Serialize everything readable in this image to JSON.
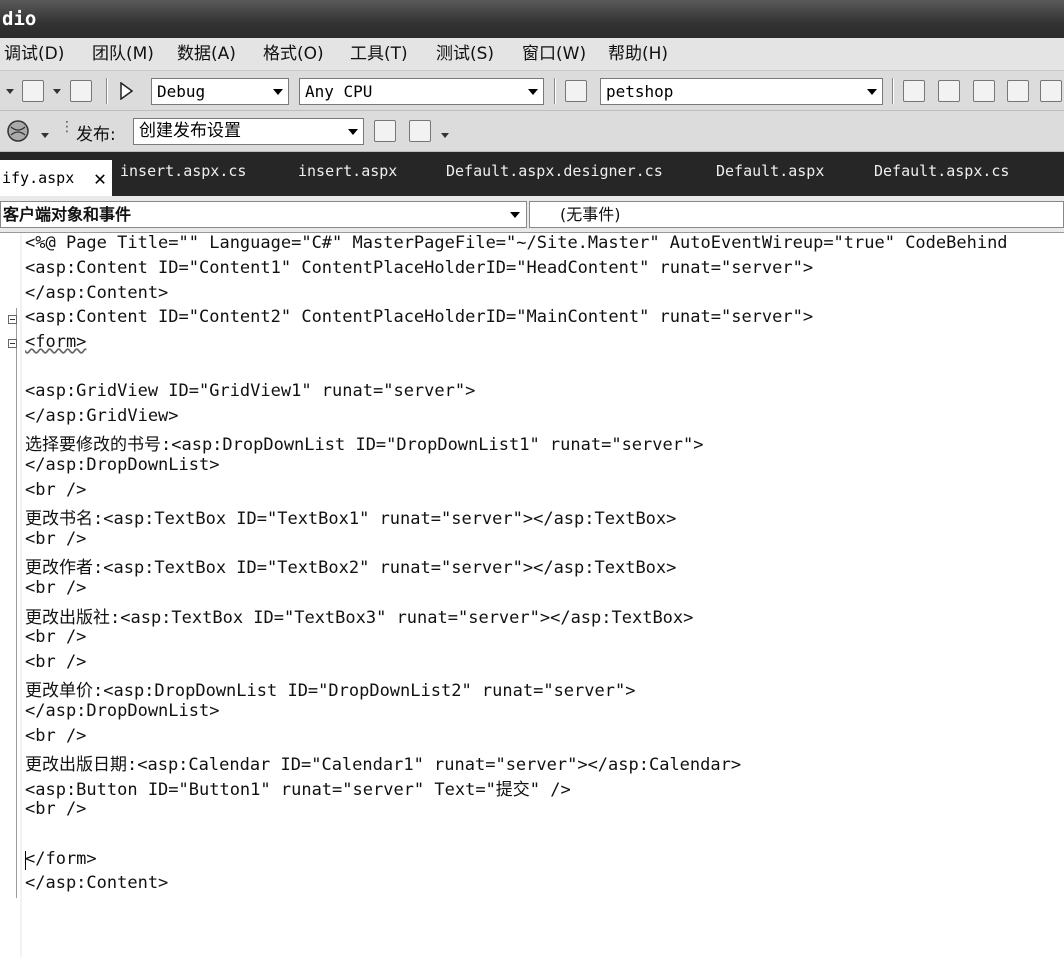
{
  "window": {
    "title": "dio"
  },
  "menu": [
    "调试(D)",
    "团队(M)",
    "数据(A)",
    "格式(O)",
    "工具(T)",
    "测试(S)",
    "窗口(W)",
    "帮助(H)"
  ],
  "toolbar1": {
    "configuration": "Debug",
    "platform": "Any CPU",
    "project": "petshop"
  },
  "toolbar2": {
    "publish_label": "发布:",
    "publish_setting": "创建发布设置"
  },
  "tabs": [
    {
      "label": "ify.aspx",
      "active": true
    },
    {
      "label": "insert.aspx.cs",
      "active": false
    },
    {
      "label": "insert.aspx",
      "active": false
    },
    {
      "label": "Default.aspx.designer.cs",
      "active": false
    },
    {
      "label": "Default.aspx",
      "active": false
    },
    {
      "label": "Default.aspx.cs",
      "active": false
    }
  ],
  "navigation": {
    "objects": "客户端对象和事件",
    "events": "(无事件)"
  },
  "code_lines": [
    "<%@ Page Title=\"\" Language=\"C#\" MasterPageFile=\"~/Site.Master\" AutoEventWireup=\"true\" CodeBehind",
    "<asp:Content ID=\"Content1\" ContentPlaceHolderID=\"HeadContent\" runat=\"server\">",
    "</asp:Content>",
    "<asp:Content ID=\"Content2\" ContentPlaceHolderID=\"MainContent\" runat=\"server\">",
    "<form>",
    "",
    "<asp:GridView ID=\"GridView1\" runat=\"server\">",
    "</asp:GridView>",
    "选择要修改的书号:<asp:DropDownList ID=\"DropDownList1\" runat=\"server\">",
    "</asp:DropDownList>",
    "<br />",
    "更改书名:<asp:TextBox ID=\"TextBox1\" runat=\"server\"></asp:TextBox>",
    "<br />",
    "更改作者:<asp:TextBox ID=\"TextBox2\" runat=\"server\"></asp:TextBox>",
    "<br />",
    "更改出版社:<asp:TextBox ID=\"TextBox3\" runat=\"server\"></asp:TextBox>",
    "<br />",
    "<br />",
    "更改单价:<asp:DropDownList ID=\"DropDownList2\" runat=\"server\">",
    "</asp:DropDownList>",
    "<br />",
    "更改出版日期:<asp:Calendar ID=\"Calendar1\" runat=\"server\"></asp:Calendar>",
    "<asp:Button ID=\"Button1\" runat=\"server\" Text=\"提交\" />",
    "<br />",
    "",
    "</form>",
    "</asp:Content>"
  ]
}
